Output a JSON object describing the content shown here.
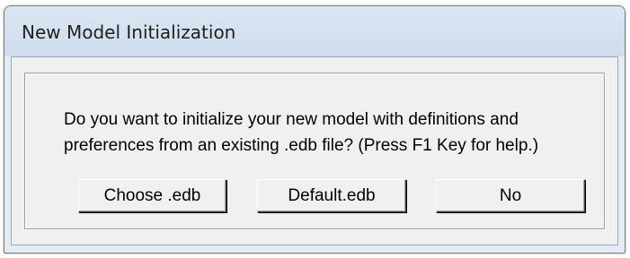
{
  "window": {
    "title": "New Model Initialization"
  },
  "dialog": {
    "message_line1": "Do you want to initialize your new model with definitions and",
    "message_line2": "preferences from an existing .edb file? (Press F1 Key for help.)"
  },
  "buttons": {
    "choose_label": "Choose .edb",
    "default_label": "Default.edb",
    "no_label": "No"
  }
}
